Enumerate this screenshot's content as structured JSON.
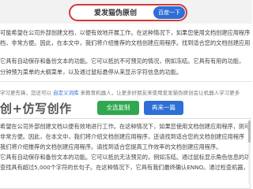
{
  "search": {
    "query": "爱发猫伪原创",
    "button_label": "百度一下"
  },
  "article": {
    "lines": [
      "可能希望在公司外部创建文档，以便有效地开展工作。在这种情况下，如果您使用文档创建应用程序",
      "档，非常方便。因此，在本文中，我们将介绍推荐的文档创建应用程序。找到适合您的文档创建应用",
      "",
      "它具有自动保存和备份文本的功能。它可以抵抗不可预见的情况，例如冻结。它具有有用的功能，",
      "分钟预为菜单的大纲菜单，以及通过鼠标悬停从来显示字符信息的功能。"
    ]
  },
  "section": {
    "nav_prefix": "学习更先锋，您还可以",
    "nav_link": "自定义词库",
    "nav_suffix": "来教育机器人，让更多好朋友来使用爱发猫伪原创会让机器人学习更多",
    "logo": "创+仿写创作",
    "copy_button": "全选复制",
    "again_button": "再来一篇"
  },
  "output": {
    "lines": [
      "希望在公司外部创建文档以便有效地进行工作。在这种情况下，如果您使用文档创建应用程序，则可",
      "非常方便。因此，在本文中，我们将介绍文档创建应用程序，还请找到适合您的文档创建应用程序",
      "我们将介绍推荐的文档创建应用程序。请找到适合您提高工作效率的文档创建应用程序。",
      "它具有自动保存和备份文本的功能。它可以抵抗无法预见的，例如冻结。通过鼠标显示角色信息的功",
      "查找具有超过5,000个字符的长句子。在这种情况下，它具有我们最终确认ENNO。通过检查机器，您可能会"
    ]
  }
}
